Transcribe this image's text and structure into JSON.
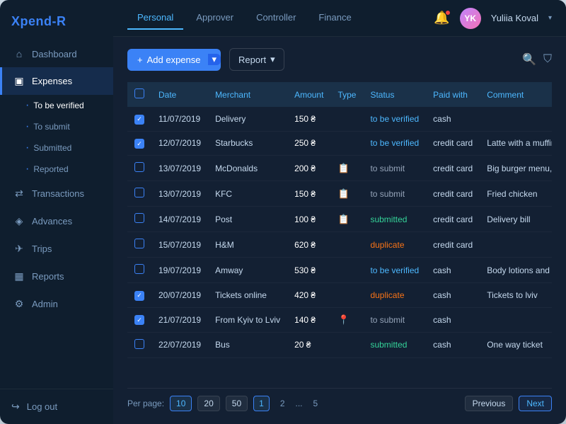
{
  "app": {
    "logo_prefix": "Xpend-",
    "logo_suffix": "R"
  },
  "sidebar": {
    "items": [
      {
        "id": "dashboard",
        "label": "Dashboard",
        "icon": "⌂"
      },
      {
        "id": "expenses",
        "label": "Expenses",
        "icon": "📄",
        "active": true,
        "sub": [
          {
            "id": "to-be-verified",
            "label": "To be verified",
            "active": true
          },
          {
            "id": "to-submit",
            "label": "To submit"
          },
          {
            "id": "submitted",
            "label": "Submitted"
          },
          {
            "id": "reported",
            "label": "Reported"
          }
        ]
      },
      {
        "id": "transactions",
        "label": "Transactions",
        "icon": "↔"
      },
      {
        "id": "advances",
        "label": "Advances",
        "icon": "💰"
      },
      {
        "id": "trips",
        "label": "Trips",
        "icon": "✈"
      },
      {
        "id": "reports",
        "label": "Reports",
        "icon": "📊"
      },
      {
        "id": "admin",
        "label": "Admin",
        "icon": "⚙"
      }
    ],
    "logout_label": "Log out",
    "logout_icon": "➜"
  },
  "topnav": {
    "tabs": [
      {
        "id": "personal",
        "label": "Personal",
        "active": true
      },
      {
        "id": "approver",
        "label": "Approver"
      },
      {
        "id": "controller",
        "label": "Controller"
      },
      {
        "id": "finance",
        "label": "Finance"
      }
    ],
    "user": {
      "name": "Yuliia Koval",
      "initials": "YK"
    }
  },
  "toolbar": {
    "add_expense_label": "Add expense",
    "report_label": "Report"
  },
  "table": {
    "columns": [
      "",
      "Date",
      "Merchant",
      "Amount",
      "Type",
      "Status",
      "Paid with",
      "Comment"
    ],
    "rows": [
      {
        "checked": true,
        "date": "11/07/2019",
        "merchant": "Delivery",
        "amount": "150 ₴",
        "type": "",
        "status": "to be verified",
        "status_class": "status-verified",
        "paid": "cash",
        "comment": ""
      },
      {
        "checked": true,
        "date": "12/07/2019",
        "merchant": "Starbucks",
        "amount": "250 ₴",
        "type": "",
        "status": "to be verified",
        "status_class": "status-verified",
        "paid": "credit card",
        "comment": "Latte with a muffin"
      },
      {
        "checked": false,
        "date": "13/07/2019",
        "merchant": "McDonalds",
        "amount": "200 ₴",
        "type": "doc",
        "status": "to submit",
        "status_class": "status-submit",
        "paid": "credit card",
        "comment": "Big burger menu, cola light"
      },
      {
        "checked": false,
        "date": "13/07/2019",
        "merchant": "KFC",
        "amount": "150 ₴",
        "type": "doc",
        "status": "to submit",
        "status_class": "status-submit",
        "paid": "credit card",
        "comment": "Fried chicken"
      },
      {
        "checked": false,
        "date": "14/07/2019",
        "merchant": "Post",
        "amount": "100 ₴",
        "type": "doc",
        "status": "submitted",
        "status_class": "status-submitted",
        "paid": "credit card",
        "comment": "Delivery bill"
      },
      {
        "checked": false,
        "date": "15/07/2019",
        "merchant": "H&M",
        "amount": "620 ₴",
        "type": "",
        "status": "duplicate",
        "status_class": "status-duplicate",
        "paid": "credit card",
        "comment": ""
      },
      {
        "checked": false,
        "date": "19/07/2019",
        "merchant": "Amway",
        "amount": "530 ₴",
        "type": "",
        "status": "to be verified",
        "status_class": "status-verified",
        "paid": "cash",
        "comment": "Body lotions and scrub"
      },
      {
        "checked": true,
        "date": "20/07/2019",
        "merchant": "Tickets online",
        "amount": "420 ₴",
        "type": "",
        "status": "duplicate",
        "status_class": "status-duplicate",
        "paid": "cash",
        "comment": "Tickets to lviv"
      },
      {
        "checked": true,
        "date": "21/07/2019",
        "merchant": "From Kyiv to Lviv",
        "amount": "140 ₴",
        "type": "loc",
        "status": "to submit",
        "status_class": "status-submit",
        "paid": "cash",
        "comment": ""
      },
      {
        "checked": false,
        "date": "22/07/2019",
        "merchant": "Bus",
        "amount": "20 ₴",
        "type": "",
        "status": "submitted",
        "status_class": "status-submitted",
        "paid": "cash",
        "comment": "One way ticket"
      }
    ]
  },
  "pagination": {
    "per_page_label": "Per page:",
    "per_page_options": [
      "10",
      "20",
      "50"
    ],
    "per_page_active": "10",
    "pages": [
      "1",
      "2",
      "...",
      "5"
    ],
    "current_page": "1",
    "prev_label": "Previous",
    "next_label": "Next"
  }
}
